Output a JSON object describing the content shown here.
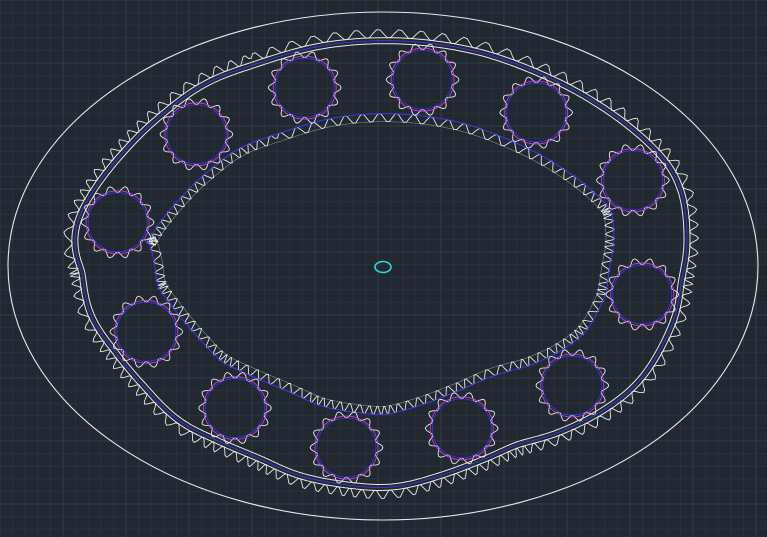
{
  "canvas": {
    "background": "#212830",
    "grid_minor": "#2a323c",
    "grid_major": "#323c47"
  },
  "drawing": {
    "geometry_color": "#e8e8e8",
    "pitch_circle_color": "#3a3aff",
    "accent_color": "#d040d0",
    "center_marker_color": "#3ad2e0",
    "planet_gear_count": 12
  }
}
